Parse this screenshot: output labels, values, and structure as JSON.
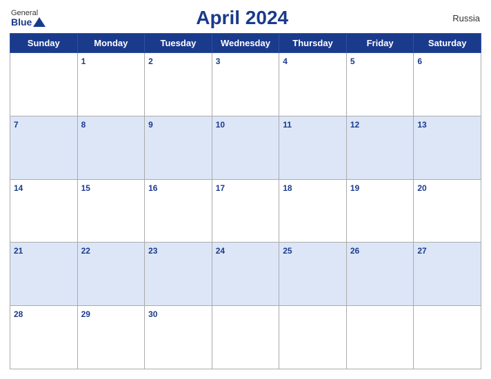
{
  "header": {
    "logo_general": "General",
    "logo_blue": "Blue",
    "title": "April 2024",
    "country": "Russia"
  },
  "weekdays": [
    "Sunday",
    "Monday",
    "Tuesday",
    "Wednesday",
    "Thursday",
    "Friday",
    "Saturday"
  ],
  "weeks": [
    [
      {
        "day": "",
        "empty": true
      },
      {
        "day": "1"
      },
      {
        "day": "2"
      },
      {
        "day": "3"
      },
      {
        "day": "4"
      },
      {
        "day": "5"
      },
      {
        "day": "6"
      }
    ],
    [
      {
        "day": "7"
      },
      {
        "day": "8"
      },
      {
        "day": "9"
      },
      {
        "day": "10"
      },
      {
        "day": "11"
      },
      {
        "day": "12"
      },
      {
        "day": "13"
      }
    ],
    [
      {
        "day": "14"
      },
      {
        "day": "15"
      },
      {
        "day": "16"
      },
      {
        "day": "17"
      },
      {
        "day": "18"
      },
      {
        "day": "19"
      },
      {
        "day": "20"
      }
    ],
    [
      {
        "day": "21"
      },
      {
        "day": "22"
      },
      {
        "day": "23"
      },
      {
        "day": "24"
      },
      {
        "day": "25"
      },
      {
        "day": "26"
      },
      {
        "day": "27"
      }
    ],
    [
      {
        "day": "28"
      },
      {
        "day": "29"
      },
      {
        "day": "30"
      },
      {
        "day": "",
        "empty": true
      },
      {
        "day": "",
        "empty": true
      },
      {
        "day": "",
        "empty": true
      },
      {
        "day": "",
        "empty": true
      }
    ]
  ],
  "colors": {
    "header_bg": "#1a3a8c",
    "row_blue": "#dce6f7",
    "row_white": "#ffffff"
  }
}
